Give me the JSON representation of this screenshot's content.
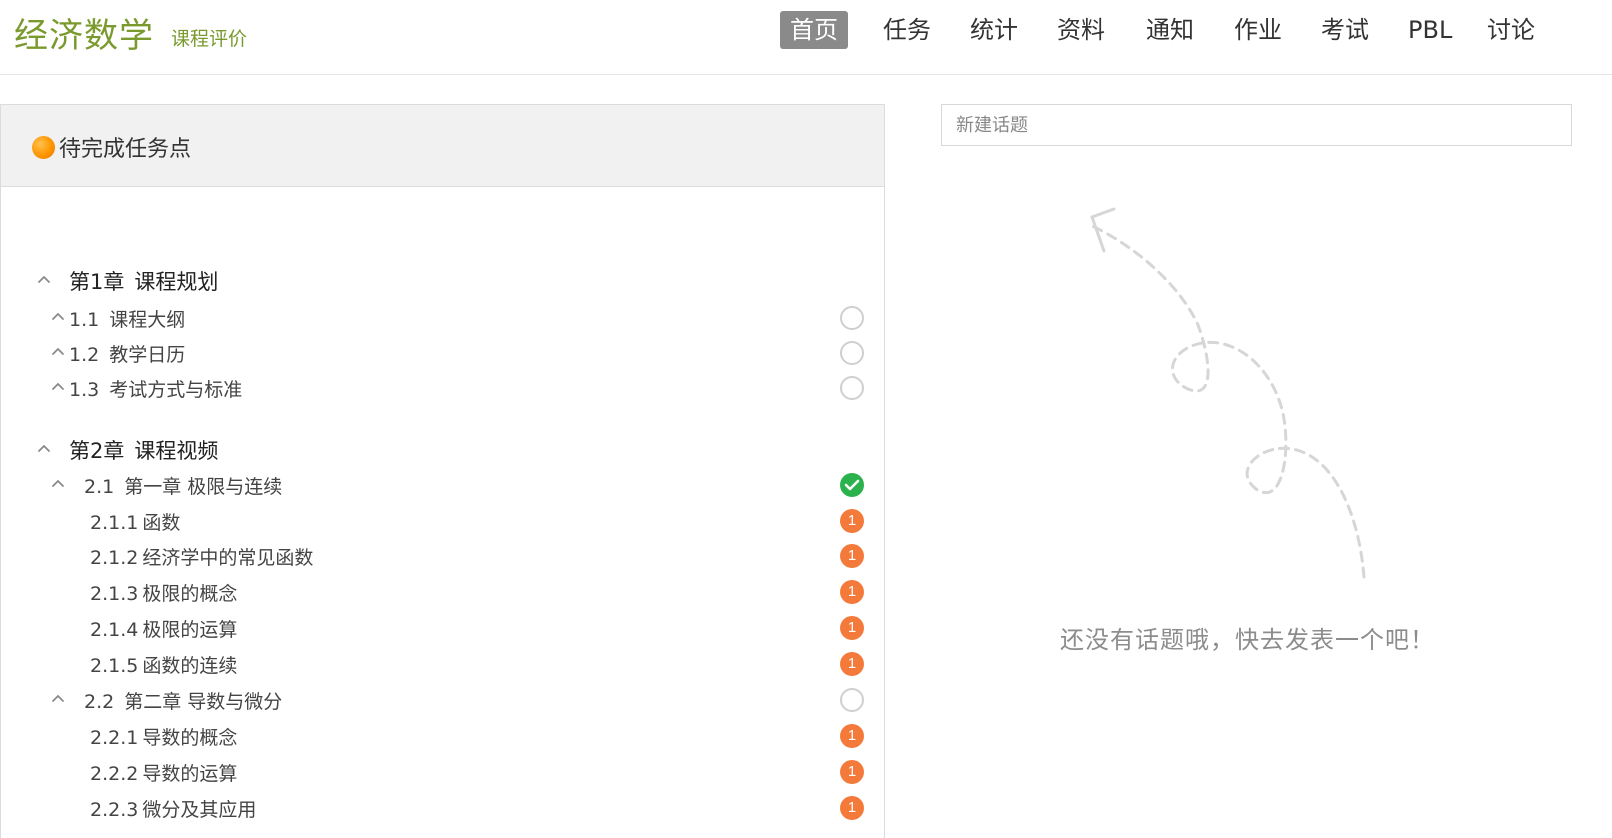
{
  "header": {
    "course_title": "经济数学",
    "course_evaluation": "课程评价",
    "nav": [
      {
        "label": "首页",
        "active": true
      },
      {
        "label": "任务",
        "active": false
      },
      {
        "label": "统计",
        "active": false
      },
      {
        "label": "资料",
        "active": false
      },
      {
        "label": "通知",
        "active": false
      },
      {
        "label": "作业",
        "active": false
      },
      {
        "label": "考试",
        "active": false
      },
      {
        "label": "PBL",
        "active": false
      },
      {
        "label": "讨论",
        "active": false
      }
    ]
  },
  "task_panel": {
    "title": "待完成任务点",
    "rows": [
      {
        "level": "chapter",
        "num": "第1章",
        "label": "课程规划",
        "expanded": true
      },
      {
        "level": "section",
        "num": "1.1",
        "label": "课程大纲",
        "status": "empty"
      },
      {
        "level": "section",
        "num": "1.2",
        "label": "教学日历",
        "status": "empty"
      },
      {
        "level": "section",
        "num": "1.3",
        "label": "考试方式与标准",
        "status": "empty"
      },
      {
        "level": "chapter",
        "num": "第2章",
        "label": "课程视频",
        "expanded": true
      },
      {
        "level": "section",
        "num": "2.1",
        "label": "第一章 极限与连续",
        "status": "done",
        "expanded": true
      },
      {
        "level": "sub",
        "num": "2.1.1",
        "label": "函数",
        "status": "pending",
        "count": "1"
      },
      {
        "level": "sub",
        "num": "2.1.2",
        "label": "经济学中的常见函数",
        "status": "pending",
        "count": "1"
      },
      {
        "level": "sub",
        "num": "2.1.3",
        "label": "极限的概念",
        "status": "pending",
        "count": "1"
      },
      {
        "level": "sub",
        "num": "2.1.4",
        "label": "极限的运算",
        "status": "pending",
        "count": "1"
      },
      {
        "level": "sub",
        "num": "2.1.5",
        "label": "函数的连续",
        "status": "pending",
        "count": "1"
      },
      {
        "level": "section",
        "num": "2.2",
        "label": "第二章 导数与微分",
        "status": "empty",
        "expanded": true
      },
      {
        "level": "sub",
        "num": "2.2.1",
        "label": "导数的概念",
        "status": "pending",
        "count": "1"
      },
      {
        "level": "sub",
        "num": "2.2.2",
        "label": "导数的运算",
        "status": "pending",
        "count": "1"
      },
      {
        "level": "sub",
        "num": "2.2.3",
        "label": "微分及其应用",
        "status": "pending",
        "count": "1"
      }
    ]
  },
  "discussion": {
    "new_topic_placeholder": "新建话题",
    "empty_message": "还没有话题哦，快去发表一个吧！"
  },
  "colors": {
    "brand_green": "#7a9a2e",
    "nav_active_bg": "#8a8a8a",
    "done_green": "#2bb24c",
    "pending_orange": "#f47a3b",
    "task_dot_orange": "#ff9500"
  }
}
